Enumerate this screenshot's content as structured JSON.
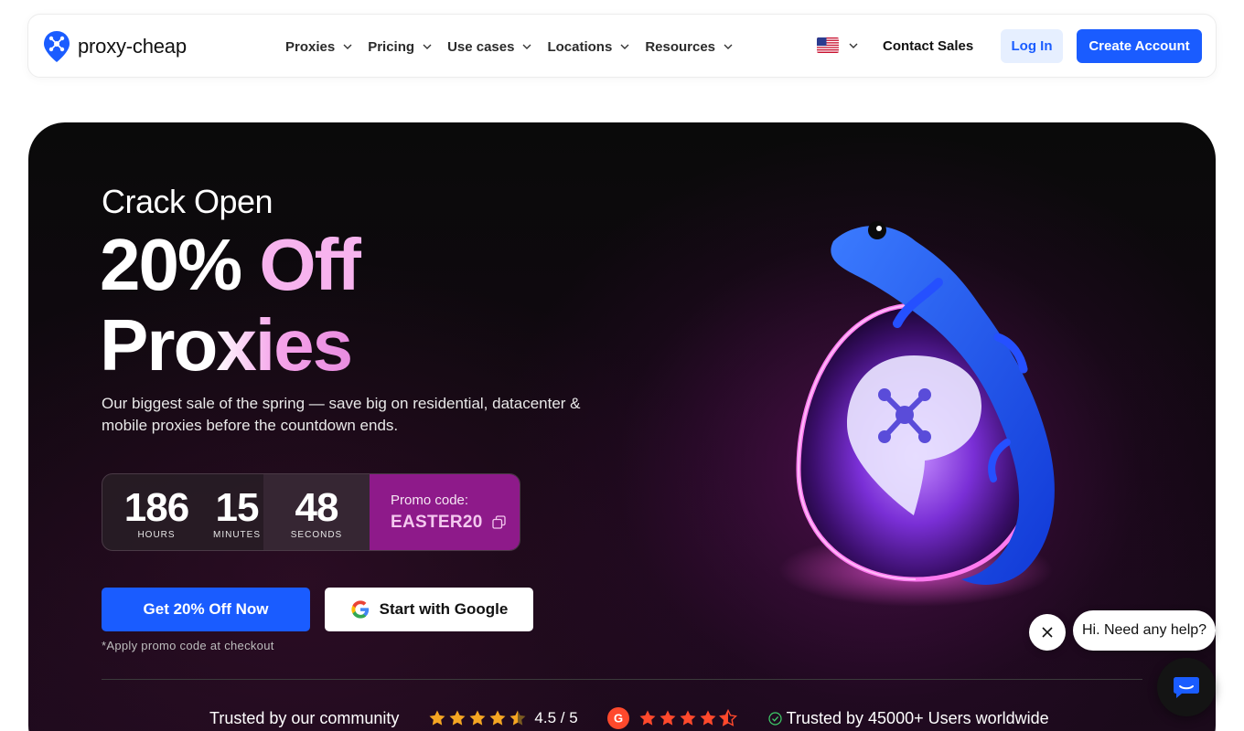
{
  "nav": {
    "logo_text": "proxy-cheap",
    "menu": [
      {
        "label": "Proxies"
      },
      {
        "label": "Pricing"
      },
      {
        "label": "Use cases"
      },
      {
        "label": "Locations"
      },
      {
        "label": "Resources"
      }
    ],
    "language_icon": "us-flag-icon",
    "contact_sales": "Contact Sales",
    "login": "Log In",
    "create_account": "Create Account"
  },
  "hero": {
    "eyebrow": "Crack Open",
    "headline_line1_a": "20%",
    "headline_line1_b": "Off",
    "headline_line2": "Proxies",
    "description": "Our biggest sale of the spring — save big on residential, datacenter & mobile proxies before the countdown ends.",
    "countdown": {
      "hours": "186",
      "hours_label": "HOURS",
      "minutes": "15",
      "minutes_label": "MINUTES",
      "seconds": "48",
      "seconds_label": "SECONDS"
    },
    "promo": {
      "label": "Promo code:",
      "code": "EASTER20"
    },
    "cta_primary": "Get 20% Off Now",
    "cta_google": "Start with Google",
    "apply_note": "*Apply promo code at checkout"
  },
  "trust": {
    "community": "Trusted by our community",
    "rating": "4.5 / 5",
    "users": "Trusted by 45000+ Users worldwide"
  },
  "chat": {
    "bubble": "Hi. Need any help?"
  },
  "colors": {
    "accent": "#1a5cff",
    "promo_bg": "#8e1a8a",
    "star": "#f5a623",
    "g2_red": "#ff492c"
  }
}
